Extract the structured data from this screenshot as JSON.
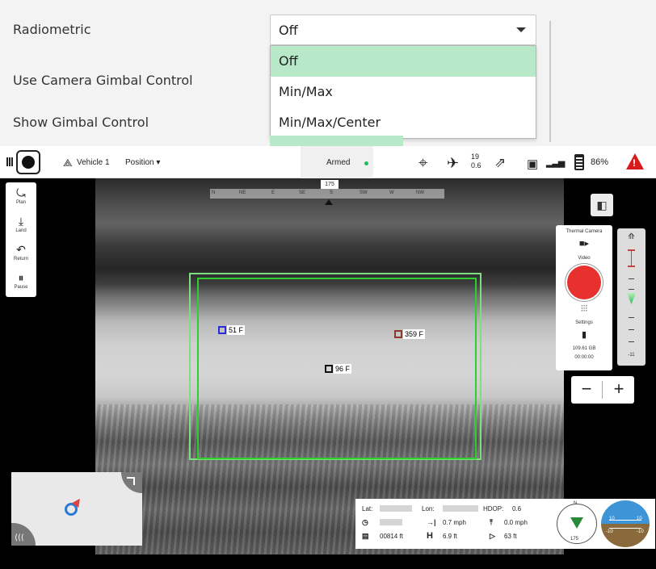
{
  "settings": {
    "radiometric_label": "Radiometric",
    "radiometric_value": "Off",
    "radiometric_options": [
      "Off",
      "Min/Max",
      "Min/Max/Center"
    ],
    "gimbal_control_label": "Use Camera Gimbal Control",
    "show_gimbal_label": "Show Gimbal Control"
  },
  "toolbar": {
    "vehicle": "Vehicle 1",
    "mode": "Position ▾",
    "armed": "Armed",
    "satellites": "19",
    "hdop": "0.6",
    "battery": "86%"
  },
  "compass": {
    "heading": "175",
    "directions": [
      "N",
      "NE",
      "E",
      "SE",
      "S",
      "SW",
      "W",
      "NW"
    ]
  },
  "tools": [
    {
      "icon": "plan-icon",
      "label": "Plan"
    },
    {
      "icon": "land-icon",
      "label": "Land"
    },
    {
      "icon": "return-icon",
      "label": "Return"
    },
    {
      "icon": "pause-icon",
      "label": "Pause"
    }
  ],
  "spots": {
    "min": "51 F",
    "max": "359 F",
    "center": "96 F"
  },
  "camera": {
    "title": "Thermal Camera",
    "mode": "Video",
    "settings": "Settings",
    "storage": "109.61 GB",
    "time": "00:00:00",
    "gimbal_value": "-11"
  },
  "telemetry": {
    "lat_label": "Lat:",
    "lon_label": "Lon:",
    "hdop_label": "HDOP:",
    "hdop_value": "0.6",
    "h_speed": "0.7 mph",
    "v_speed": "0.0 mph",
    "flight_distance": "00814 ft",
    "height": "6.9 ft",
    "distance_home": "63 ft",
    "heading": "175",
    "attitude_top": "10",
    "attitude_bottom": "-10"
  },
  "colors": {
    "record": "#e8302f",
    "armed_dot": "#1ebe5a",
    "warning": "#d91b1b",
    "roi": "#2fcf2f",
    "selected_option": "#b7e9c9"
  }
}
